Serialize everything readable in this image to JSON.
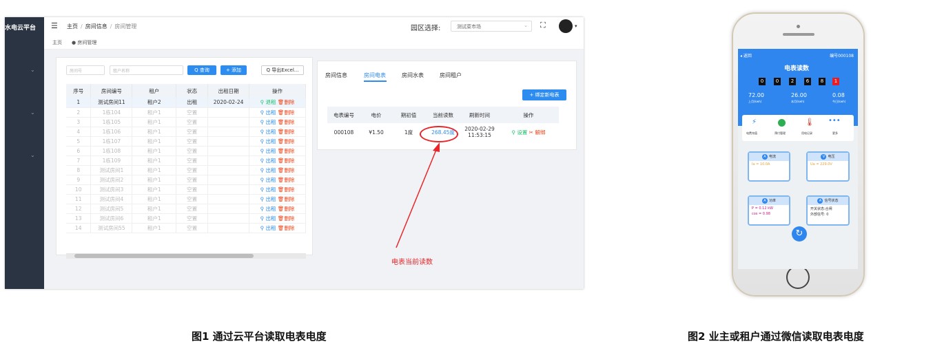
{
  "app": {
    "brand": "水电云平台"
  },
  "breadcrumb": {
    "home": "主页",
    "room_info": "房间信息",
    "current": "房间管理"
  },
  "park": {
    "label": "园区选择:",
    "selected": "测试菜市场"
  },
  "tagbar": {
    "home": "主页",
    "current": "● 房间管理"
  },
  "room_panel": {
    "room_no_placeholder": "房间号",
    "tenant_placeholder": "租户名称",
    "query_label": "Q 查询",
    "add_label": "+ 添加",
    "export_label": "Q 导出Excel...",
    "columns": [
      "序号",
      "房间编号",
      "租户",
      "状态",
      "出租日期",
      "操作"
    ],
    "rows": [
      {
        "no": "1",
        "room": "测试房间11",
        "tenant": "租户2",
        "status": "出租",
        "date": "2020-02-24",
        "op1": "退租",
        "op2": "删除"
      },
      {
        "no": "2",
        "room": "1栋104",
        "tenant": "租户1",
        "status": "空置",
        "date": "",
        "op1": "出租",
        "op2": "删除"
      },
      {
        "no": "3",
        "room": "1栋105",
        "tenant": "租户1",
        "status": "空置",
        "date": "",
        "op1": "出租",
        "op2": "删除"
      },
      {
        "no": "4",
        "room": "1栋106",
        "tenant": "租户1",
        "status": "空置",
        "date": "",
        "op1": "出租",
        "op2": "删除"
      },
      {
        "no": "5",
        "room": "1栋107",
        "tenant": "租户1",
        "status": "空置",
        "date": "",
        "op1": "出租",
        "op2": "删除"
      },
      {
        "no": "6",
        "room": "1栋108",
        "tenant": "租户1",
        "status": "空置",
        "date": "",
        "op1": "出租",
        "op2": "删除"
      },
      {
        "no": "7",
        "room": "1栋109",
        "tenant": "租户1",
        "status": "空置",
        "date": "",
        "op1": "出租",
        "op2": "删除"
      },
      {
        "no": "8",
        "room": "测试房间1",
        "tenant": "租户1",
        "status": "空置",
        "date": "",
        "op1": "出租",
        "op2": "删除"
      },
      {
        "no": "9",
        "room": "测试房间2",
        "tenant": "租户1",
        "status": "空置",
        "date": "",
        "op1": "出租",
        "op2": "删除"
      },
      {
        "no": "10",
        "room": "测试房间3",
        "tenant": "租户1",
        "status": "空置",
        "date": "",
        "op1": "出租",
        "op2": "删除"
      },
      {
        "no": "11",
        "room": "测试房间4",
        "tenant": "租户1",
        "status": "空置",
        "date": "",
        "op1": "出租",
        "op2": "删除"
      },
      {
        "no": "12",
        "room": "测试房间5",
        "tenant": "租户1",
        "status": "空置",
        "date": "",
        "op1": "出租",
        "op2": "删除"
      },
      {
        "no": "13",
        "room": "测试房间6",
        "tenant": "租户1",
        "status": "空置",
        "date": "",
        "op1": "出租",
        "op2": "删除"
      },
      {
        "no": "14",
        "room": "测试房间55",
        "tenant": "租户1",
        "status": "空置",
        "date": "",
        "op1": "出租",
        "op2": "删除"
      }
    ]
  },
  "detail_panel": {
    "tabs": [
      "房间信息",
      "房间电表",
      "房间水表",
      "房间租户"
    ],
    "bind_label": "+ 绑定新电表",
    "columns": [
      "电表编号",
      "电价",
      "期初值",
      "当前读数",
      "刷新时间",
      "操作"
    ],
    "row": {
      "meter_no": "000108",
      "price": "¥1.50",
      "initial": "1度",
      "reading": "268.45度",
      "time1": "2020-02-29",
      "time2": "11:53:15",
      "op1": "设置",
      "op2": "解绑"
    }
  },
  "annotation": "电表当前读数",
  "captions": {
    "fig1": "图1 通过云平台读取电表电度",
    "fig2": "图2 业主或租户通过微信读取电表电度"
  },
  "phone": {
    "back": "◂ 返回",
    "meter_no": "编号000108",
    "title": "电表读数",
    "digits": [
      "0",
      "0",
      "2",
      "6",
      "8",
      "1"
    ],
    "stats": [
      {
        "value": "72.00",
        "label": "上月(kwh)"
      },
      {
        "value": "26.00",
        "label": "本月(kwh)"
      },
      {
        "value": "0.08",
        "label": "今日(kwh)"
      }
    ],
    "menu": [
      "电费充值",
      "预付管理",
      "用电记录",
      "更多"
    ],
    "cards": [
      {
        "badge": "A",
        "title": "电流",
        "lines": [
          "Ia = 10.0A"
        ]
      },
      {
        "badge": "V",
        "title": "电压",
        "lines": [
          "Ua = 229.0V"
        ]
      },
      {
        "badge": "A",
        "title": "功率",
        "lines": [
          "P = 0.12 kW",
          "cos = 0.98"
        ]
      },
      {
        "badge": "A",
        "title": "信号状态",
        "lines": [
          "开关状态:合闸",
          "外部信号: 0"
        ]
      }
    ]
  },
  "colors": {
    "accent": "#2d8cf0",
    "sidebar": "#2b3442",
    "danger": "#ed4014",
    "annotation": "#e8262a",
    "phone_header": "#2f86ee"
  }
}
